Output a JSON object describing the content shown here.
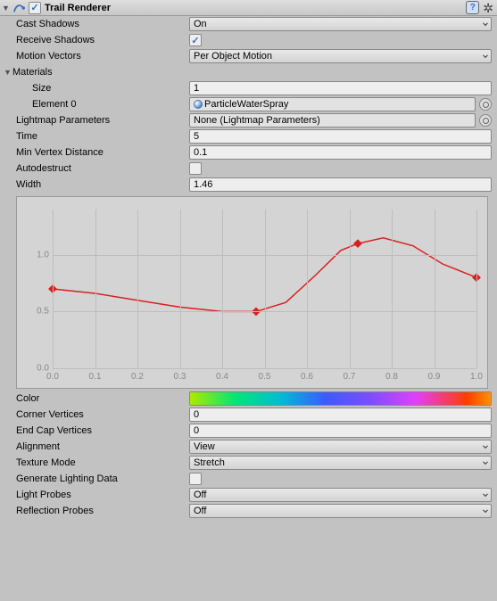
{
  "header": {
    "title": "Trail Renderer",
    "enabled": true
  },
  "castShadows": {
    "label": "Cast Shadows",
    "value": "On"
  },
  "receiveShadows": {
    "label": "Receive Shadows",
    "checked": true
  },
  "motionVectors": {
    "label": "Motion Vectors",
    "value": "Per Object Motion"
  },
  "materials": {
    "label": "Materials",
    "size": {
      "label": "Size",
      "value": "1"
    },
    "element0": {
      "label": "Element 0",
      "value": "ParticleWaterSpray"
    }
  },
  "lightmapParams": {
    "label": "Lightmap Parameters",
    "value": "None (Lightmap Parameters)"
  },
  "time": {
    "label": "Time",
    "value": "5"
  },
  "minVertexDistance": {
    "label": "Min Vertex Distance",
    "value": "0.1"
  },
  "autodestruct": {
    "label": "Autodestruct",
    "checked": false
  },
  "width": {
    "label": "Width",
    "value": "1.46"
  },
  "color": {
    "label": "Color"
  },
  "cornerVertices": {
    "label": "Corner Vertices",
    "value": "0"
  },
  "endCapVertices": {
    "label": "End Cap Vertices",
    "value": "0"
  },
  "alignment": {
    "label": "Alignment",
    "value": "View"
  },
  "textureMode": {
    "label": "Texture Mode",
    "value": "Stretch"
  },
  "generateLightingData": {
    "label": "Generate Lighting Data",
    "checked": false
  },
  "lightProbes": {
    "label": "Light Probes",
    "value": "Off"
  },
  "reflectionProbes": {
    "label": "Reflection Probes",
    "value": "Off"
  },
  "chart_data": {
    "type": "line",
    "title": "",
    "xlabel": "",
    "ylabel": "",
    "xlim": [
      0.0,
      1.0
    ],
    "ylim": [
      0.0,
      1.4
    ],
    "xticks": [
      0.0,
      0.1,
      0.2,
      0.3,
      0.4,
      0.5,
      0.6,
      0.7,
      0.8,
      0.9,
      1.0
    ],
    "yticks": [
      0.0,
      0.5,
      1.0
    ],
    "keys": [
      {
        "x": 0.0,
        "y": 0.7
      },
      {
        "x": 0.48,
        "y": 0.5
      },
      {
        "x": 0.72,
        "y": 1.1
      },
      {
        "x": 1.0,
        "y": 0.8
      }
    ],
    "curve": [
      {
        "x": 0.0,
        "y": 0.7
      },
      {
        "x": 0.1,
        "y": 0.66
      },
      {
        "x": 0.2,
        "y": 0.6
      },
      {
        "x": 0.3,
        "y": 0.54
      },
      {
        "x": 0.4,
        "y": 0.5
      },
      {
        "x": 0.48,
        "y": 0.5
      },
      {
        "x": 0.55,
        "y": 0.58
      },
      {
        "x": 0.62,
        "y": 0.82
      },
      {
        "x": 0.68,
        "y": 1.04
      },
      {
        "x": 0.72,
        "y": 1.1
      },
      {
        "x": 0.78,
        "y": 1.15
      },
      {
        "x": 0.85,
        "y": 1.08
      },
      {
        "x": 0.92,
        "y": 0.92
      },
      {
        "x": 1.0,
        "y": 0.8
      }
    ]
  }
}
